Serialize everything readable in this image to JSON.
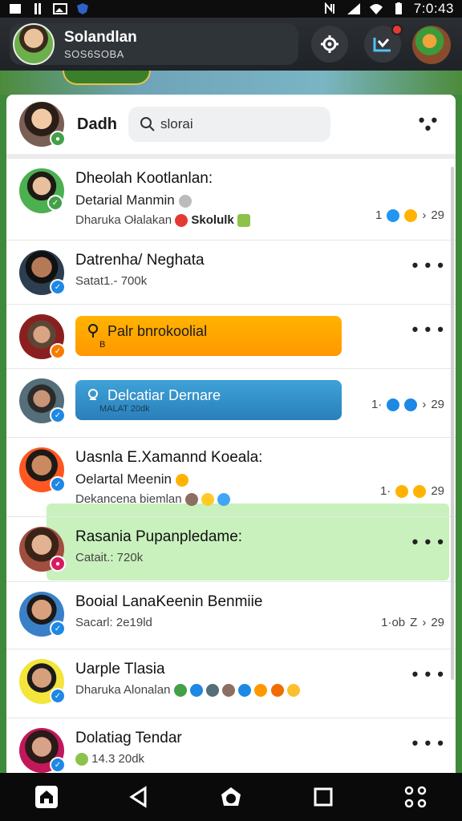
{
  "status_bar": {
    "time": "7:0:43"
  },
  "header": {
    "profile_name": "Solandlan",
    "profile_sub": "SOS6SOBA"
  },
  "card_top": {
    "title": "Dadh",
    "search_placeholder": "slorai",
    "search_value": "slorai"
  },
  "chats": [
    {
      "name": "Dheolah Kootlanlan:",
      "sub": "Detarial Manmin",
      "preview": "Dharuka Ołalakan",
      "preview_tail": "Skolulk",
      "meta": "1"
    },
    {
      "name": "Datrenha/ Neghata",
      "sub": "Satat1.- 700k"
    },
    {
      "pill_title": "Palr bnrokoolial",
      "pill_sub": "B"
    },
    {
      "pill_title": "Delcatiar Dernare",
      "pill_sub": "MALAT 20dk",
      "meta": "1·"
    },
    {
      "name": "Uasnla E.Xamannd Koeala:",
      "sub": "Oelartal Meenin",
      "preview": "Dekancena biemlan",
      "meta": "1·"
    },
    {
      "name": "Rasania Pupanpledame:",
      "sub": "Catait.: 720k"
    },
    {
      "name": "Booial LanaKeenin Benmiie",
      "sub": "Sacarl: 2e19ld",
      "meta": "1·ob"
    },
    {
      "name": "Uarple Tlasia",
      "sub": "Dharuka Alonalan"
    },
    {
      "name": "Dolatiag Tendar",
      "sub": "14.3 20dk"
    }
  ],
  "meta_tail": "29",
  "icons": {
    "settings": "gear-icon",
    "compose": "compose-icon",
    "search": "search-icon",
    "more": "more-icon"
  },
  "colors": {
    "accent_orange": "#ff9800",
    "accent_blue": "#2a7fba",
    "highlight_green": "#c9f1bd"
  }
}
